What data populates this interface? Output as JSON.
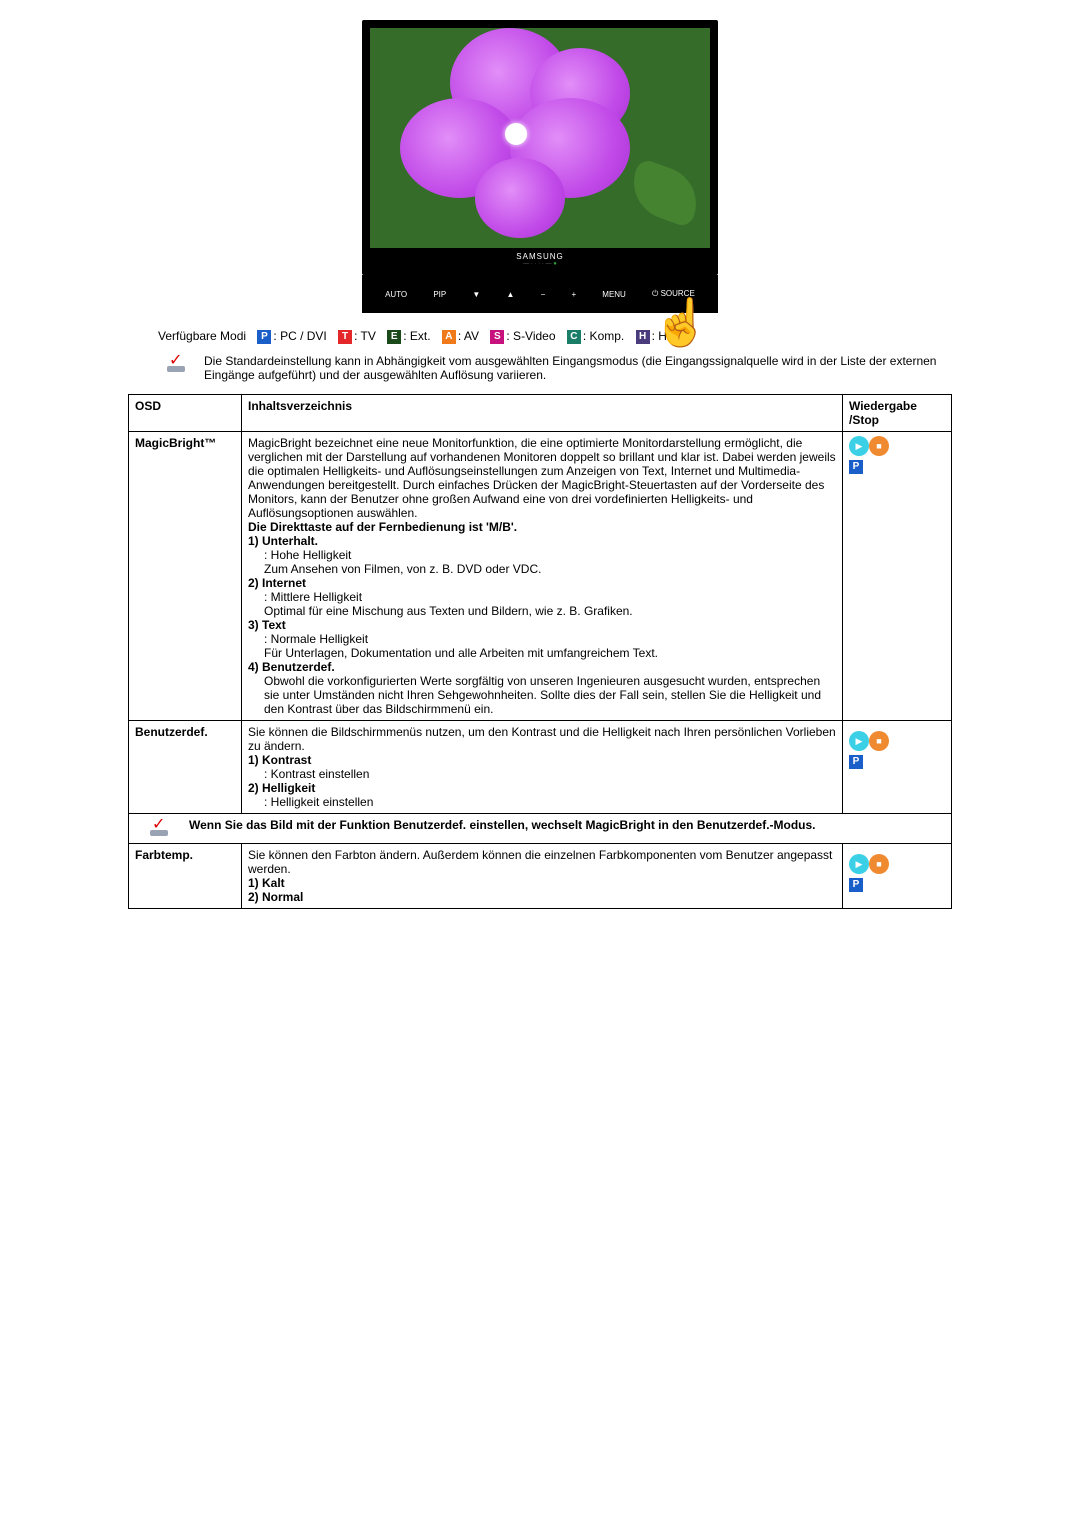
{
  "monitor": {
    "brand": "SAMSUNG"
  },
  "remote_buttons": [
    "AUTO",
    "PIP",
    "▼",
    "▲",
    "−",
    "+",
    "MENU",
    "⏻ SOURCE"
  ],
  "available_modes": {
    "label": "Verfügbare Modi",
    "items": [
      {
        "badge": "P",
        "text": ": PC / DVI"
      },
      {
        "badge": "T",
        "text": ": TV"
      },
      {
        "badge": "E",
        "text": ": Ext."
      },
      {
        "badge": "A",
        "text": ": AV"
      },
      {
        "badge": "S",
        "text": ": S-Video"
      },
      {
        "badge": "C",
        "text": ": Komp."
      },
      {
        "badge": "H",
        "text": ": HDMI"
      }
    ]
  },
  "note": "Die Standardeinstellung kann in Abhängigkeit vom ausgewählten Eingangsmodus (die Eingangssignalquelle wird in der Liste der externen Eingänge aufgeführt) und der ausgewählten Auflösung variieren.",
  "table": {
    "headers": {
      "osd": "OSD",
      "contents": "Inhaltsverzeichnis",
      "play": "Wiedergabe /Stop"
    },
    "rows": {
      "magicbright": {
        "name": "MagicBright™",
        "intro": "MagicBright bezeichnet eine neue Monitorfunktion, die eine optimierte Monitordarstellung ermöglicht, die verglichen mit der Darstellung auf vorhandenen Monitoren doppelt so brillant und klar ist. Dabei werden jeweils die optimalen Helligkeits- und Auflösungseinstellungen zum Anzeigen von Text, Internet und Multimedia-Anwendungen bereitgestellt. Durch einfaches Drücken der MagicBright-Steuertasten auf der Vorderseite des Monitors, kann der Benutzer ohne großen Aufwand eine von drei vordefinierten Helligkeits- und Auflösungsoptionen auswählen.",
        "direct": "Die Direkttaste auf der Fernbedienung ist 'M/B'.",
        "opt1_h": "1) Unterhalt.",
        "opt1_a": ": Hohe Helligkeit",
        "opt1_b": "Zum Ansehen von Filmen, von z. B. DVD oder VDC.",
        "opt2_h": "2) Internet",
        "opt2_a": ": Mittlere Helligkeit",
        "opt2_b": "Optimal für eine Mischung aus Texten und Bildern, wie z. B. Grafiken.",
        "opt3_h": "3) Text",
        "opt3_a": ": Normale Helligkeit",
        "opt3_b": "Für Unterlagen, Dokumentation und alle Arbeiten mit umfangreichem Text.",
        "opt4_h": "4) Benutzerdef.",
        "opt4_a": "Obwohl die vorkonfigurierten Werte sorgfältig von unseren Ingenieuren ausgesucht wurden, entsprechen sie unter Umständen nicht Ihren Sehgewohnheiten. Sollte dies der Fall sein, stellen Sie die Helligkeit und den Kontrast über das Bildschirmmenü ein."
      },
      "benutzerdef": {
        "name": "Benutzerdef.",
        "intro": "Sie können die Bildschirmmenüs nutzen, um den Kontrast und die Helligkeit nach Ihren persönlichen Vorlieben zu ändern.",
        "opt1_h": "1) Kontrast",
        "opt1_a": ": Kontrast einstellen",
        "opt2_h": "2) Helligkeit",
        "opt2_a": ": Helligkeit einstellen"
      },
      "note_row": {
        "text": "Wenn Sie das Bild mit der Funktion Benutzerdef. einstellen, wechselt MagicBright in den Benutzerdef.-Modus."
      },
      "farbtemp": {
        "name": "Farbtemp.",
        "intro": "Sie können den Farbton ändern. Außerdem können die einzelnen Farbkomponenten vom Benutzer angepasst werden.",
        "opt1_h": "1) Kalt",
        "opt2_h": "2) Normal"
      }
    },
    "play_mode": "P"
  }
}
